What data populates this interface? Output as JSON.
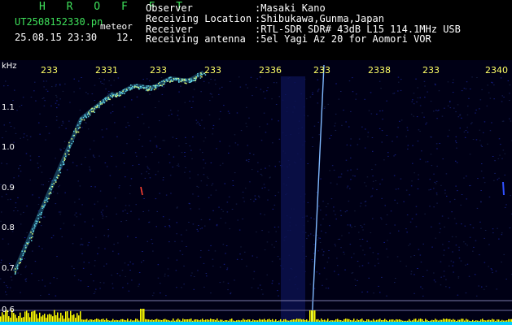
{
  "header": {
    "brand": "H R O F F T",
    "filename": "UT2508152330.pn",
    "meteor_label": "meteor",
    "timestamp": "25.08.15 23:30",
    "meteor_count": "12.",
    "rows": [
      {
        "label": "Observer",
        "value": ":Masaki Kano"
      },
      {
        "label": "Receiving Location",
        "value": ":Shibukawa,Gunma,Japan"
      },
      {
        "label": "Receiver",
        "value": ":RTL-SDR SDR# 43dB L15 114.1MHz USB"
      },
      {
        "label": "Receiving antenna",
        "value": ":5el Yagi Az 20 for Aomori VOR"
      }
    ]
  },
  "plot": {
    "y_unit": "kHz",
    "y_ticks": [
      "1.1",
      "1.0",
      "0.9",
      "0.8",
      "0.7",
      "0.6"
    ],
    "x_ticks": [
      "233",
      "2331",
      "233",
      "233",
      "2336",
      "233",
      "2338",
      "233",
      "2340"
    ]
  }
}
